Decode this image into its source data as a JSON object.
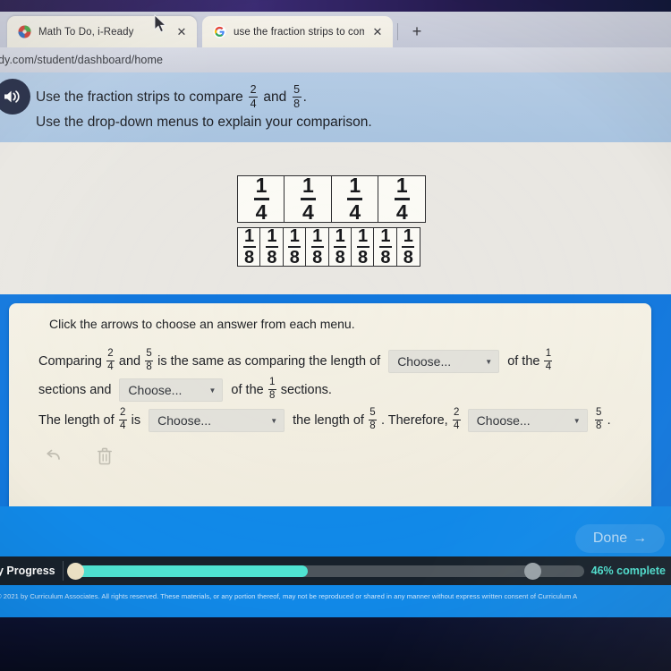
{
  "browser": {
    "tabs": [
      {
        "title": "Math To Do, i-Ready",
        "favicon": "iready-logo-icon",
        "close": "✕"
      },
      {
        "title": "use the fraction strips to compar",
        "favicon": "google-g-icon",
        "close": "✕"
      }
    ],
    "new_tab_label": "+",
    "url": "dy.com/student/dashboard/home"
  },
  "question": {
    "speaker_icon": "speaker-icon",
    "line1_a": "Use the fraction strips to compare",
    "line1_and": "and",
    "line1_period": ".",
    "line2": "Use the drop-down menus to explain your comparison.",
    "fraction_a": {
      "num": "2",
      "den": "4"
    },
    "fraction_b": {
      "num": "5",
      "den": "8"
    }
  },
  "strips": {
    "quarters": {
      "count": 4,
      "num": "1",
      "den": "4"
    },
    "eighths": {
      "count": 8,
      "num": "1",
      "den": "8"
    }
  },
  "answer": {
    "speaker_icon": "speaker-icon",
    "instruction": "Click the arrows to choose an answer from each menu.",
    "line1": {
      "t1": "Comparing",
      "t2": "and",
      "t3": "is the same as comparing the length of",
      "t4": "of the"
    },
    "line2": {
      "t1": "sections and",
      "t2": "of the",
      "t3": "sections."
    },
    "line3": {
      "t1": "The length of",
      "t2": "is",
      "t3": "the length of",
      "t4": ". Therefore,",
      "t5": "."
    },
    "dropdowns": [
      {
        "value": "Choose...",
        "caret": "▼"
      },
      {
        "value": "Choose...",
        "caret": "▼"
      },
      {
        "value": "Choose...",
        "caret": "▼"
      },
      {
        "value": "Choose...",
        "caret": "▼"
      }
    ],
    "fractions": {
      "two_fourths": {
        "num": "2",
        "den": "4"
      },
      "five_eighths": {
        "num": "5",
        "den": "8"
      },
      "one_fourth": {
        "num": "1",
        "den": "4"
      },
      "one_eighth": {
        "num": "1",
        "den": "8"
      }
    },
    "tools": [
      {
        "name": "undo-icon"
      },
      {
        "name": "delete-icon"
      }
    ]
  },
  "footer": {
    "done_label": "Done",
    "done_arrow": "→",
    "progress_label": "y Progress",
    "progress_percent_label": "46% complete",
    "progress_percent": 46,
    "copyright": "© 2021 by Curriculum Associates. All rights reserved. These materials, or any portion thereof, may not be reproduced or shared in any manner without express written consent of Curriculum A"
  },
  "colors": {
    "page_blue": "#1189e8",
    "banner_blue": "#b4cbe4",
    "card_cream": "#f4f1e5",
    "progress_teal": "#4fe3d2",
    "progress_bg": "#17212b"
  }
}
